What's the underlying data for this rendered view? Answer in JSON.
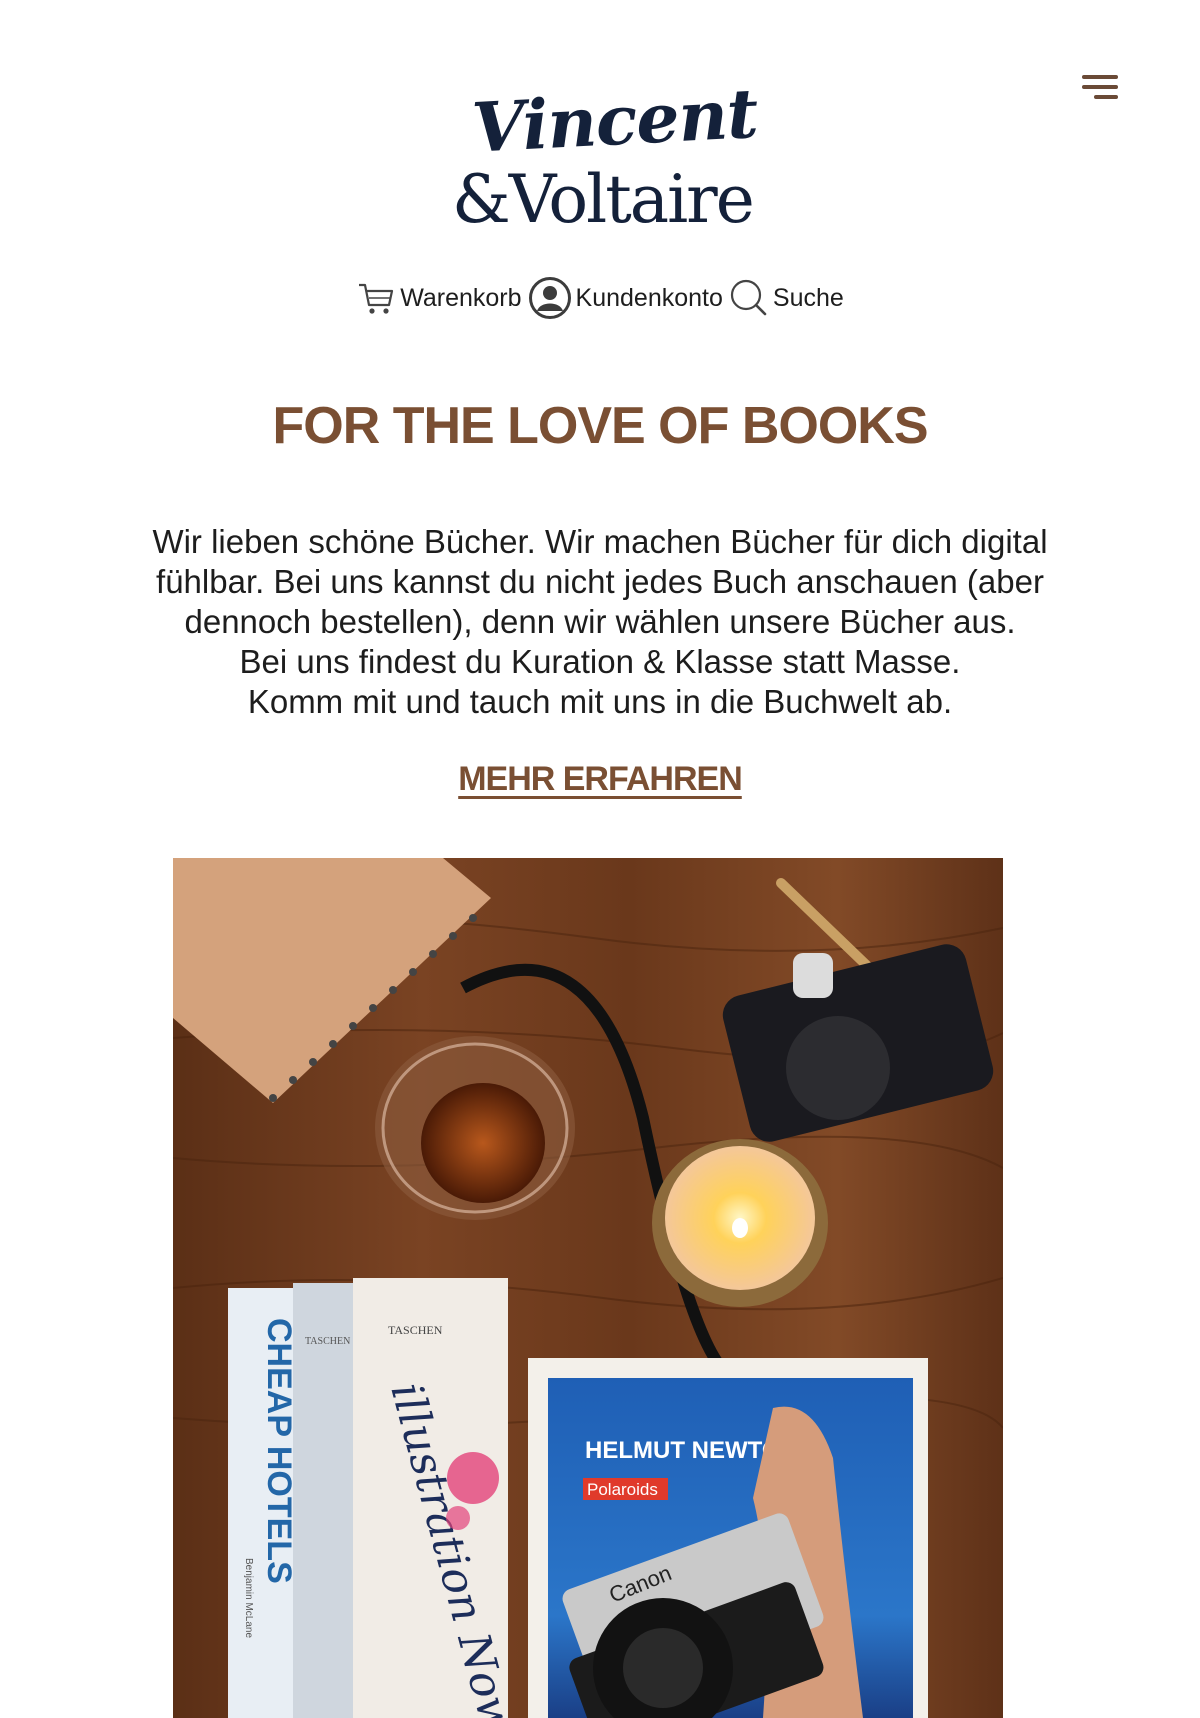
{
  "brand": {
    "name_line1": "Vincent",
    "name_line2": "&Voltaire"
  },
  "header": {
    "menu_icon": "hamburger-menu-icon",
    "nav": [
      {
        "label": "Warenkorb",
        "icon": "cart-icon"
      },
      {
        "label": "Kundenkonto",
        "icon": "account-icon"
      },
      {
        "label": "Suche",
        "icon": "search-icon"
      }
    ]
  },
  "hero": {
    "title": "FOR THE LOVE OF BOOKS",
    "text_lines": [
      "Wir lieben schöne Bücher. Wir machen Bücher für dich digital",
      "fühlbar. Bei uns kannst du nicht jedes Buch anschauen (aber",
      "dennoch bestellen), denn wir wählen unsere Bücher aus.",
      "Bei uns findest du Kuration & Klasse statt Masse.",
      "Komm mit und tauch mit uns in die Buchwelt ab."
    ],
    "cta_label": "MEHR ERFAHREN"
  },
  "photo": {
    "book_spine_1": "CHEAP HOTELS",
    "book_spine_1_author": "Benjamin McLane",
    "publisher_1": "TASCHEN",
    "publisher_2": "TASCHEN",
    "book_spine_2": "illustration Now!",
    "book_cover_author": "HELMUT NEWTON",
    "book_cover_title": "Polaroids",
    "camera_brand": "Canon"
  },
  "colors": {
    "accent_brown": "#7a4f33",
    "logo_navy": "#14213a",
    "text": "#1d1d1d"
  }
}
